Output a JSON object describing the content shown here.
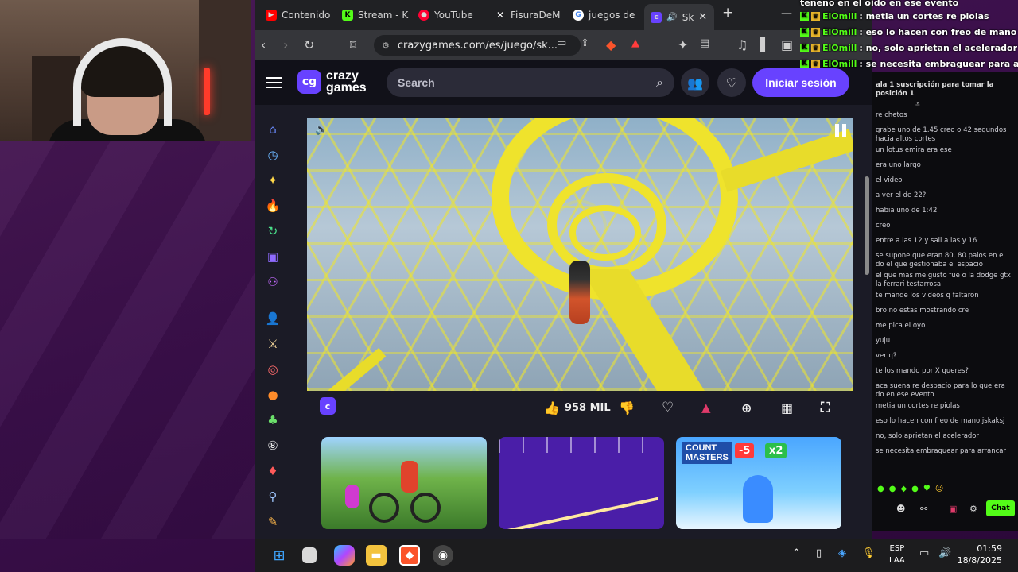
{
  "browser": {
    "tabs": [
      {
        "label": "Contenido",
        "favicon": "youtube-icon",
        "color": "#ff0000"
      },
      {
        "label": "Stream - K",
        "favicon": "kick-icon",
        "color": "#53fc18"
      },
      {
        "label": "YouTube",
        "favicon": "youtube-icon",
        "color": "#ff0033"
      },
      {
        "label": "FisuraDeM",
        "favicon": "x-icon",
        "color": "#000000"
      },
      {
        "label": "juegos de",
        "favicon": "google-icon",
        "color": "#ffffff"
      },
      {
        "label": "Sk",
        "favicon": "crazygames-icon",
        "color": "#6842ff"
      }
    ],
    "new_tab": "+",
    "url": "crazygames.com/es/juego/sk..."
  },
  "site": {
    "logo_badge": "cg",
    "logo_line1": "crazy",
    "logo_line2": "games",
    "search_placeholder": "Search",
    "login_label": "Iniciar sesión",
    "accent_color": "#6842ff"
  },
  "game": {
    "likes": "958 MIL"
  },
  "thumbnails": [
    {
      "name": "bike-game"
    },
    {
      "name": "geometry-game"
    },
    {
      "name": "count-masters",
      "label_line1": "COUNT",
      "label_line2": "MASTERS",
      "badge1": "-5",
      "badge2": "x2"
    }
  ],
  "overlay_chat": {
    "top_line": "teneno en el oido en ese evento",
    "messages": [
      {
        "user": "ElOmill",
        "text": ": metia un cortes re piolas"
      },
      {
        "user": "ElOmill",
        "text": ": eso lo hacen con freo de mano jskaksj"
      },
      {
        "user": "ElOmill",
        "text": ": no, solo aprietan el acelerador"
      },
      {
        "user": "ElOmill",
        "text": ": se necesita embraguear para arrancar"
      }
    ]
  },
  "chat_panel": {
    "subscribe_hint": "ala 1 suscripción para tomar la posición 1",
    "messages": [
      "re chetos",
      "grabe uno de 1.45 creo o 42 segundos hacia altos cortes",
      "un lotus emira era ese",
      "era uno largo",
      "el video",
      "a ver el de 22?",
      "habia uno de 1:42",
      "creo",
      "entre a las 12 y sali a las y 16",
      "se supone que eran 80. 80 palos en el do el que gestionaba el espacio",
      "el que mas me gusto fue o la dodge gtx la ferrari testarrosa",
      "te mande los videos q faltaron",
      "bro no estas mostrando cre",
      "me pica el oyo",
      "yuju",
      "ver q?",
      "te los mando por X queres?",
      "aca suena re despacio para lo que era do en ese evento",
      "metia un cortes re piolas",
      "eso lo hacen con freo de mano jskaksj",
      "no, solo aprietan el acelerador",
      "se necesita embraguear para arrancar"
    ],
    "chat_button": "Chat",
    "kick_color": "#53fc18"
  },
  "taskbar": {
    "lang_line1": "ESP",
    "lang_line2": "LAA",
    "time": "01:59",
    "date": "18/8/2025"
  }
}
